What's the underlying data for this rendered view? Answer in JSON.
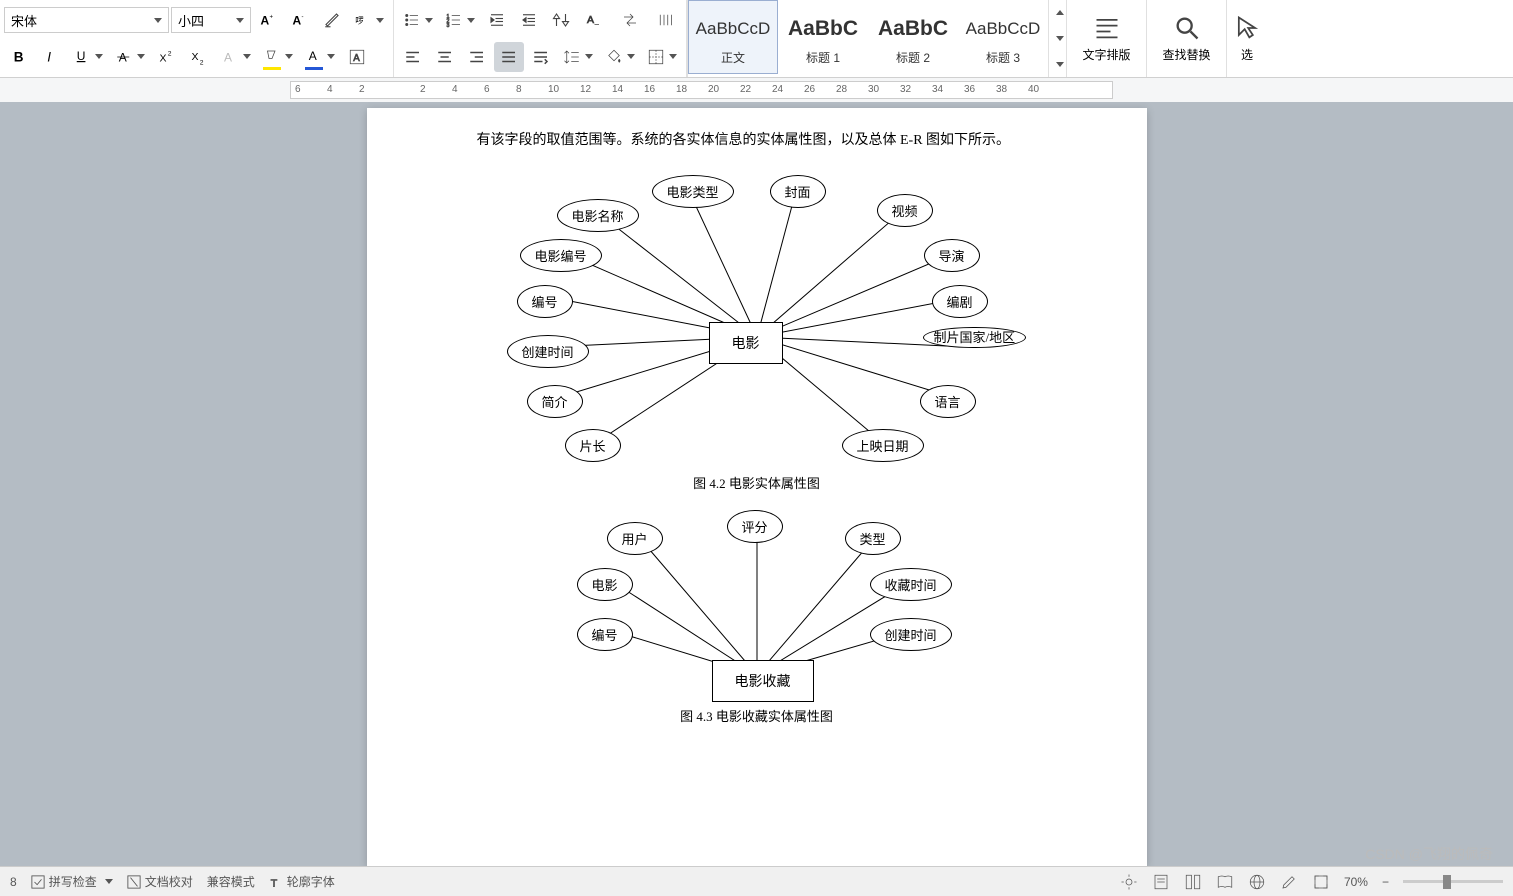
{
  "toolbar": {
    "font_name": "宋体",
    "font_size": "小四",
    "styles": [
      {
        "preview": "AaBbCcD",
        "label": "正文",
        "bold": false,
        "active": true
      },
      {
        "preview": "AaBbC",
        "label": "标题 1",
        "bold": true,
        "active": false
      },
      {
        "preview": "AaBbC",
        "label": "标题 2",
        "bold": true,
        "active": false
      },
      {
        "preview": "AaBbCcD",
        "label": "标题 3",
        "bold": false,
        "active": false
      }
    ],
    "layout_label": "文字排版",
    "find_label": "查找替换",
    "select_label": "选"
  },
  "ruler": {
    "marks_left": [
      "6",
      "4",
      "2"
    ],
    "marks_right": [
      "2",
      "4",
      "6",
      "8",
      "10",
      "12",
      "14",
      "16",
      "18",
      "20",
      "22",
      "24",
      "26",
      "28",
      "30",
      "32",
      "34",
      "36",
      "38",
      "40"
    ]
  },
  "document": {
    "paragraph": "有该字段的取值范围等。系统的各实体信息的实体属性图，以及总体 E-R 图如下所示。",
    "diagram1": {
      "entity": "电影",
      "attrs": [
        "电影名称",
        "电影类型",
        "封面",
        "视频",
        "导演",
        "编剧",
        "制片国家/地区",
        "语言",
        "上映日期",
        "片长",
        "简介",
        "创建时间",
        "编号",
        "电影编号"
      ],
      "caption": "图 4.2  电影实体属性图"
    },
    "diagram2": {
      "entity": "电影收藏",
      "attrs": [
        "用户",
        "评分",
        "类型",
        "收藏时间",
        "创建时间",
        "电影",
        "编号"
      ],
      "caption": "图 4.3  电影收藏实体属性图"
    }
  },
  "status": {
    "spell_check": "拼写检查",
    "doc_check": "文档校对",
    "compat": "兼容模式",
    "font_warn": "轮廓字体",
    "zoom": "70%"
  },
  "watermark": "CSDN @飞翔的佩奇"
}
